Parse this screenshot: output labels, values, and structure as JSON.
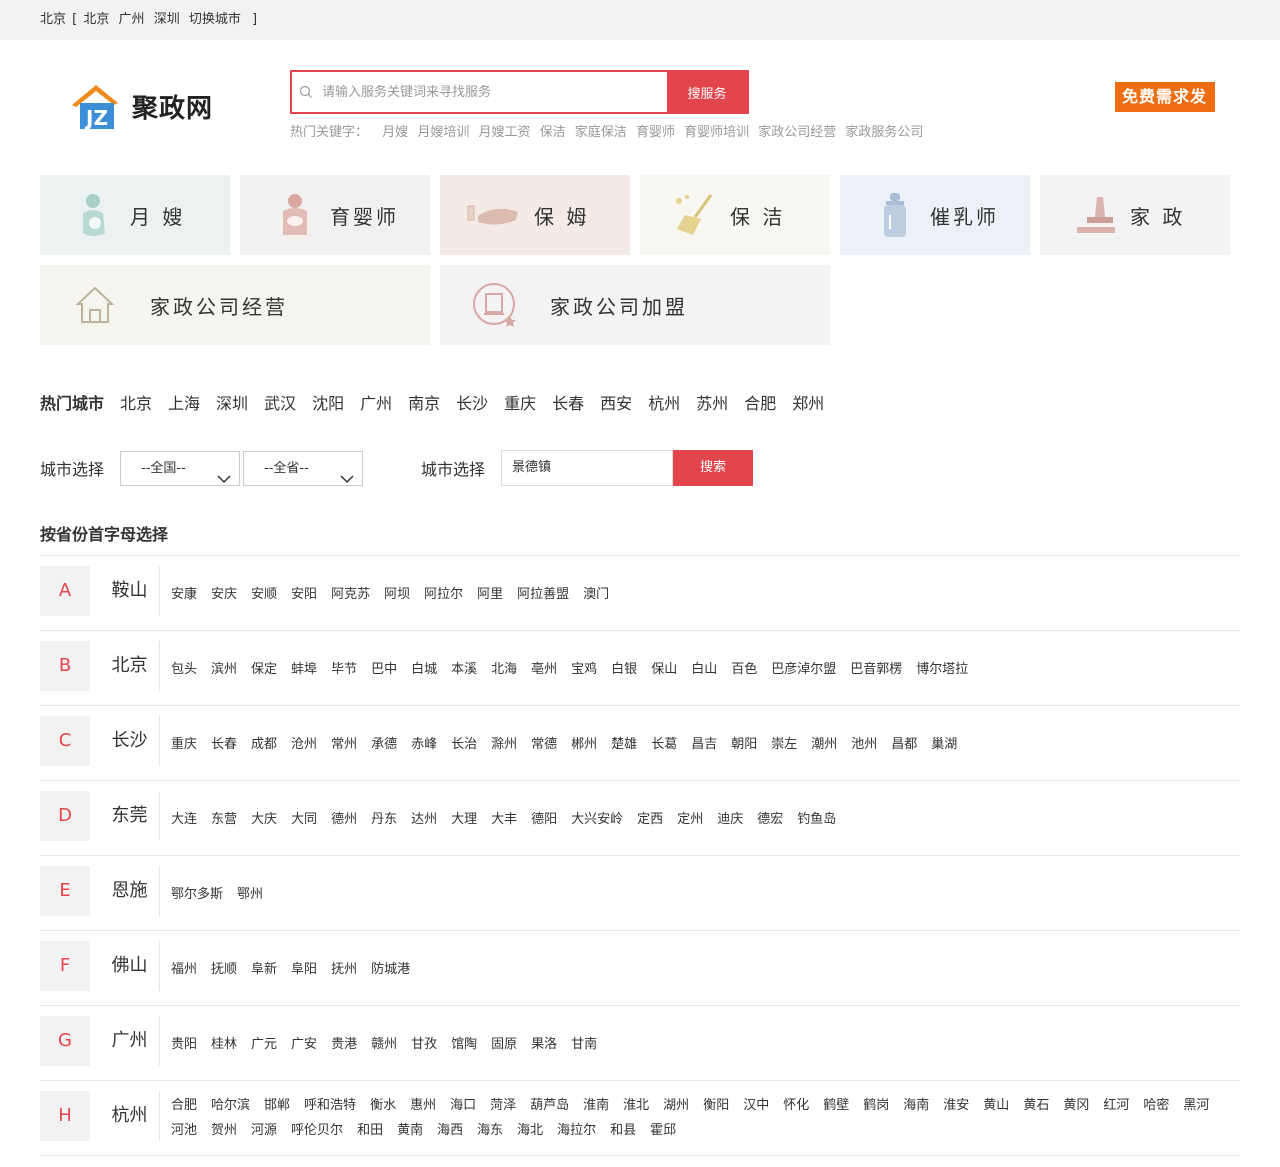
{
  "topbar": {
    "current_city": "北京",
    "open_bracket": "[",
    "close_bracket": "]",
    "links": [
      "北京",
      "广州",
      "深圳",
      "切换城市"
    ]
  },
  "logo": {
    "text": "聚政网",
    "mark_letters": "JZ"
  },
  "search": {
    "placeholder": "请输入服务关键词来寻找服务",
    "button": "搜服务"
  },
  "hotkeys": {
    "label": "热门关键字：",
    "items": [
      "月嫂",
      "月嫂培训",
      "月嫂工资",
      "保洁",
      "家庭保洁",
      "育婴师",
      "育婴师培训",
      "家政公司经营",
      "家政服务公司"
    ]
  },
  "publish": {
    "label": "免费需求发布"
  },
  "categories": [
    {
      "label": "月 嫂",
      "icon": "baby-icon",
      "bg": "#ecf1f1"
    },
    {
      "label": "育婴师",
      "icon": "nanny-icon",
      "bg": "#f3f1f0"
    },
    {
      "label": "保 姆",
      "icon": "hand-icon",
      "bg": "#f4ebe7"
    },
    {
      "label": "保 洁",
      "icon": "broom-icon",
      "bg": "#f8f6f0"
    },
    {
      "label": "催乳师",
      "icon": "bottle-icon",
      "bg": "#ecf1f7"
    },
    {
      "label": "家 政",
      "icon": "cleaning-icon",
      "bg": "#f3f3f3"
    },
    {
      "label": "家政公司经营",
      "icon": "house-icon",
      "bg": "#f6f4ee"
    },
    {
      "label": "家政公司加盟",
      "icon": "league-icon",
      "bg": "#f3f3f3"
    }
  ],
  "hotcity": {
    "title": "热门城市",
    "items": [
      "北京",
      "上海",
      "深圳",
      "武汉",
      "沈阳",
      "广州",
      "南京",
      "长沙",
      "重庆",
      "长春",
      "西安",
      "杭州",
      "苏州",
      "合肥",
      "郑州"
    ]
  },
  "cityselect": {
    "label": "城市选择",
    "country": "--全国--",
    "province": "--全省--",
    "label2": "城市选择",
    "input_value": "景德镇",
    "button": "搜索"
  },
  "province_title": "按省份首字母选择",
  "letters": [
    {
      "letter": "A",
      "capital": "鞍山",
      "cities": [
        "安康",
        "安庆",
        "安顺",
        "安阳",
        "阿克苏",
        "阿坝",
        "阿拉尔",
        "阿里",
        "阿拉善盟",
        "澳门"
      ]
    },
    {
      "letter": "B",
      "capital": "北京",
      "cities": [
        "包头",
        "滨州",
        "保定",
        "蚌埠",
        "毕节",
        "巴中",
        "白城",
        "本溪",
        "北海",
        "亳州",
        "宝鸡",
        "白银",
        "保山",
        "白山",
        "百色",
        "巴彦淖尔盟",
        "巴音郭楞",
        "博尔塔拉"
      ]
    },
    {
      "letter": "C",
      "capital": "长沙",
      "cities": [
        "重庆",
        "长春",
        "成都",
        "沧州",
        "常州",
        "承德",
        "赤峰",
        "长治",
        "滁州",
        "常德",
        "郴州",
        "楚雄",
        "长葛",
        "昌吉",
        "朝阳",
        "崇左",
        "潮州",
        "池州",
        "昌都",
        "巢湖"
      ]
    },
    {
      "letter": "D",
      "capital": "东莞",
      "cities": [
        "大连",
        "东营",
        "大庆",
        "大同",
        "德州",
        "丹东",
        "达州",
        "大理",
        "大丰",
        "德阳",
        "大兴安岭",
        "定西",
        "定州",
        "迪庆",
        "德宏",
        "钓鱼岛"
      ]
    },
    {
      "letter": "E",
      "capital": "恩施",
      "cities": [
        "鄂尔多斯",
        "鄂州"
      ]
    },
    {
      "letter": "F",
      "capital": "佛山",
      "cities": [
        "福州",
        "抚顺",
        "阜新",
        "阜阳",
        "抚州",
        "防城港"
      ]
    },
    {
      "letter": "G",
      "capital": "广州",
      "cities": [
        "贵阳",
        "桂林",
        "广元",
        "广安",
        "贵港",
        "赣州",
        "甘孜",
        "馆陶",
        "固原",
        "果洛",
        "甘南"
      ]
    },
    {
      "letter": "H",
      "capital": "杭州",
      "cities": [
        "合肥",
        "哈尔滨",
        "邯郸",
        "呼和浩特",
        "衡水",
        "惠州",
        "海口",
        "菏泽",
        "葫芦岛",
        "淮南",
        "淮北",
        "湖州",
        "衡阳",
        "汉中",
        "怀化",
        "鹤壁",
        "鹤岗",
        "海南",
        "淮安",
        "黄山",
        "黄石",
        "黄冈",
        "红河",
        "哈密",
        "黑河",
        "河池",
        "贺州",
        "河源",
        "呼伦贝尔",
        "和田",
        "黄南",
        "海西",
        "海东",
        "海北",
        "海拉尔",
        "和县",
        "霍邱"
      ]
    }
  ]
}
